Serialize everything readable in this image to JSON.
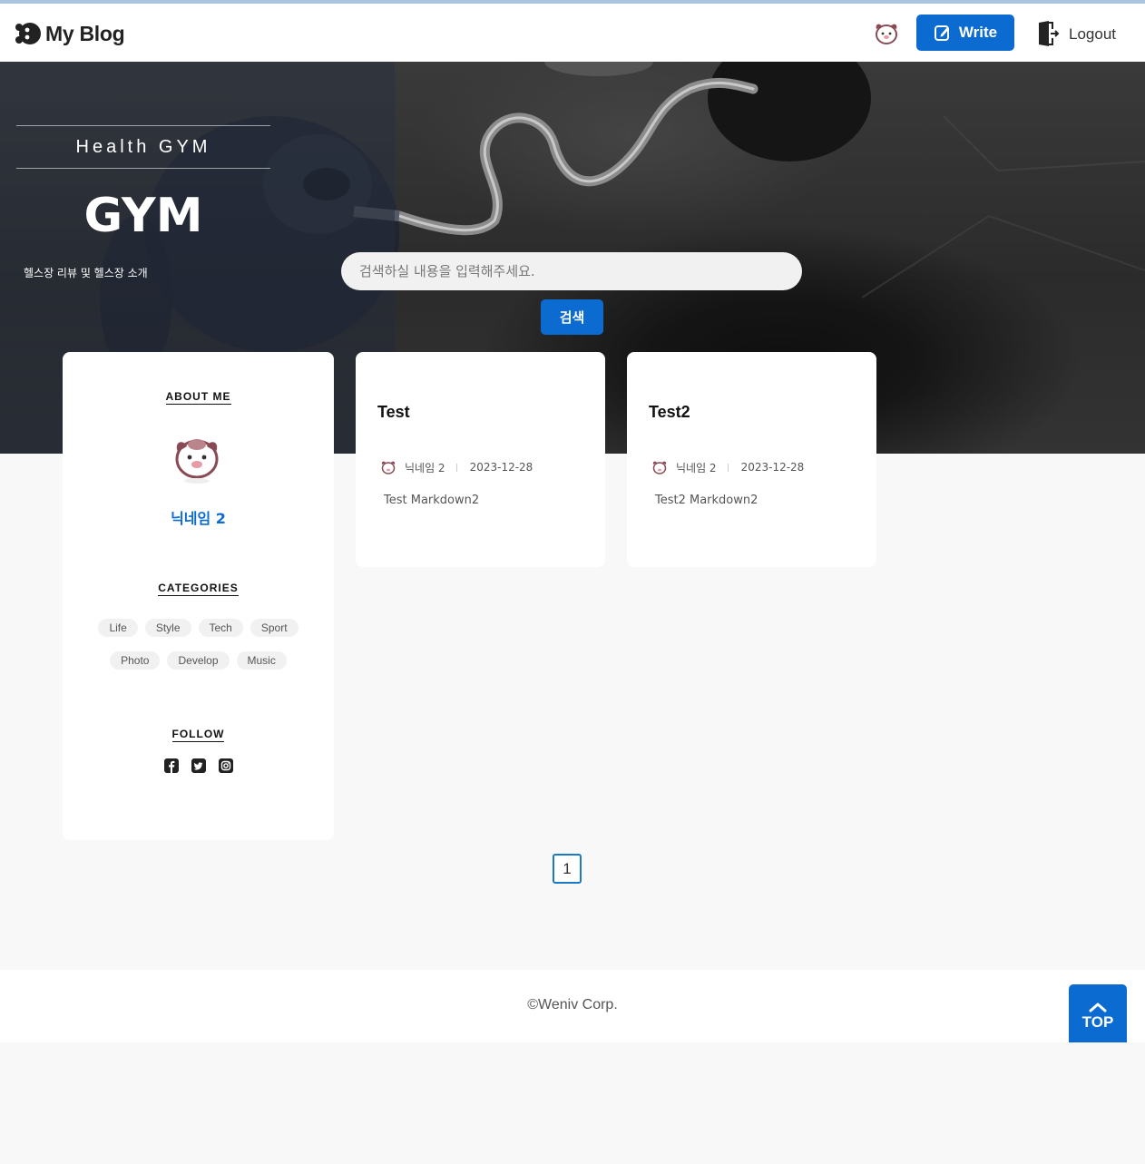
{
  "header": {
    "logo_text": "My Blog",
    "logo_icon": "weniv-logo-icon",
    "write_label": "Write",
    "logout_label": "Logout",
    "accent_color": "#0b6bd1"
  },
  "hero": {
    "subtitle": "Health GYM",
    "title": "GYM",
    "description": "헬스장 리뷰 및 헬스장 소개",
    "search_placeholder": "검색하실 내용을 입력해주세요.",
    "search_button": "검색"
  },
  "sidebar": {
    "about_title": "ABOUT ME",
    "nickname": "닉네임 2",
    "categories_title": "CATEGORIES",
    "categories": [
      "Life",
      "Style",
      "Tech",
      "Sport",
      "Photo",
      "Develop",
      "Music"
    ],
    "follow_title": "FOLLOW",
    "follow_icons": [
      "facebook-icon",
      "twitter-icon",
      "instagram-icon"
    ]
  },
  "posts": [
    {
      "title": "Test",
      "author": "닉네임 2",
      "date": "2023-12-28",
      "description": "Test Markdown2"
    },
    {
      "title": "Test2",
      "author": "닉네임 2",
      "date": "2023-12-28",
      "description": "Test2 Markdown2"
    }
  ],
  "pagination": {
    "current": "1"
  },
  "footer": {
    "copyright": "©Weniv Corp.",
    "top_label": "TOP"
  }
}
